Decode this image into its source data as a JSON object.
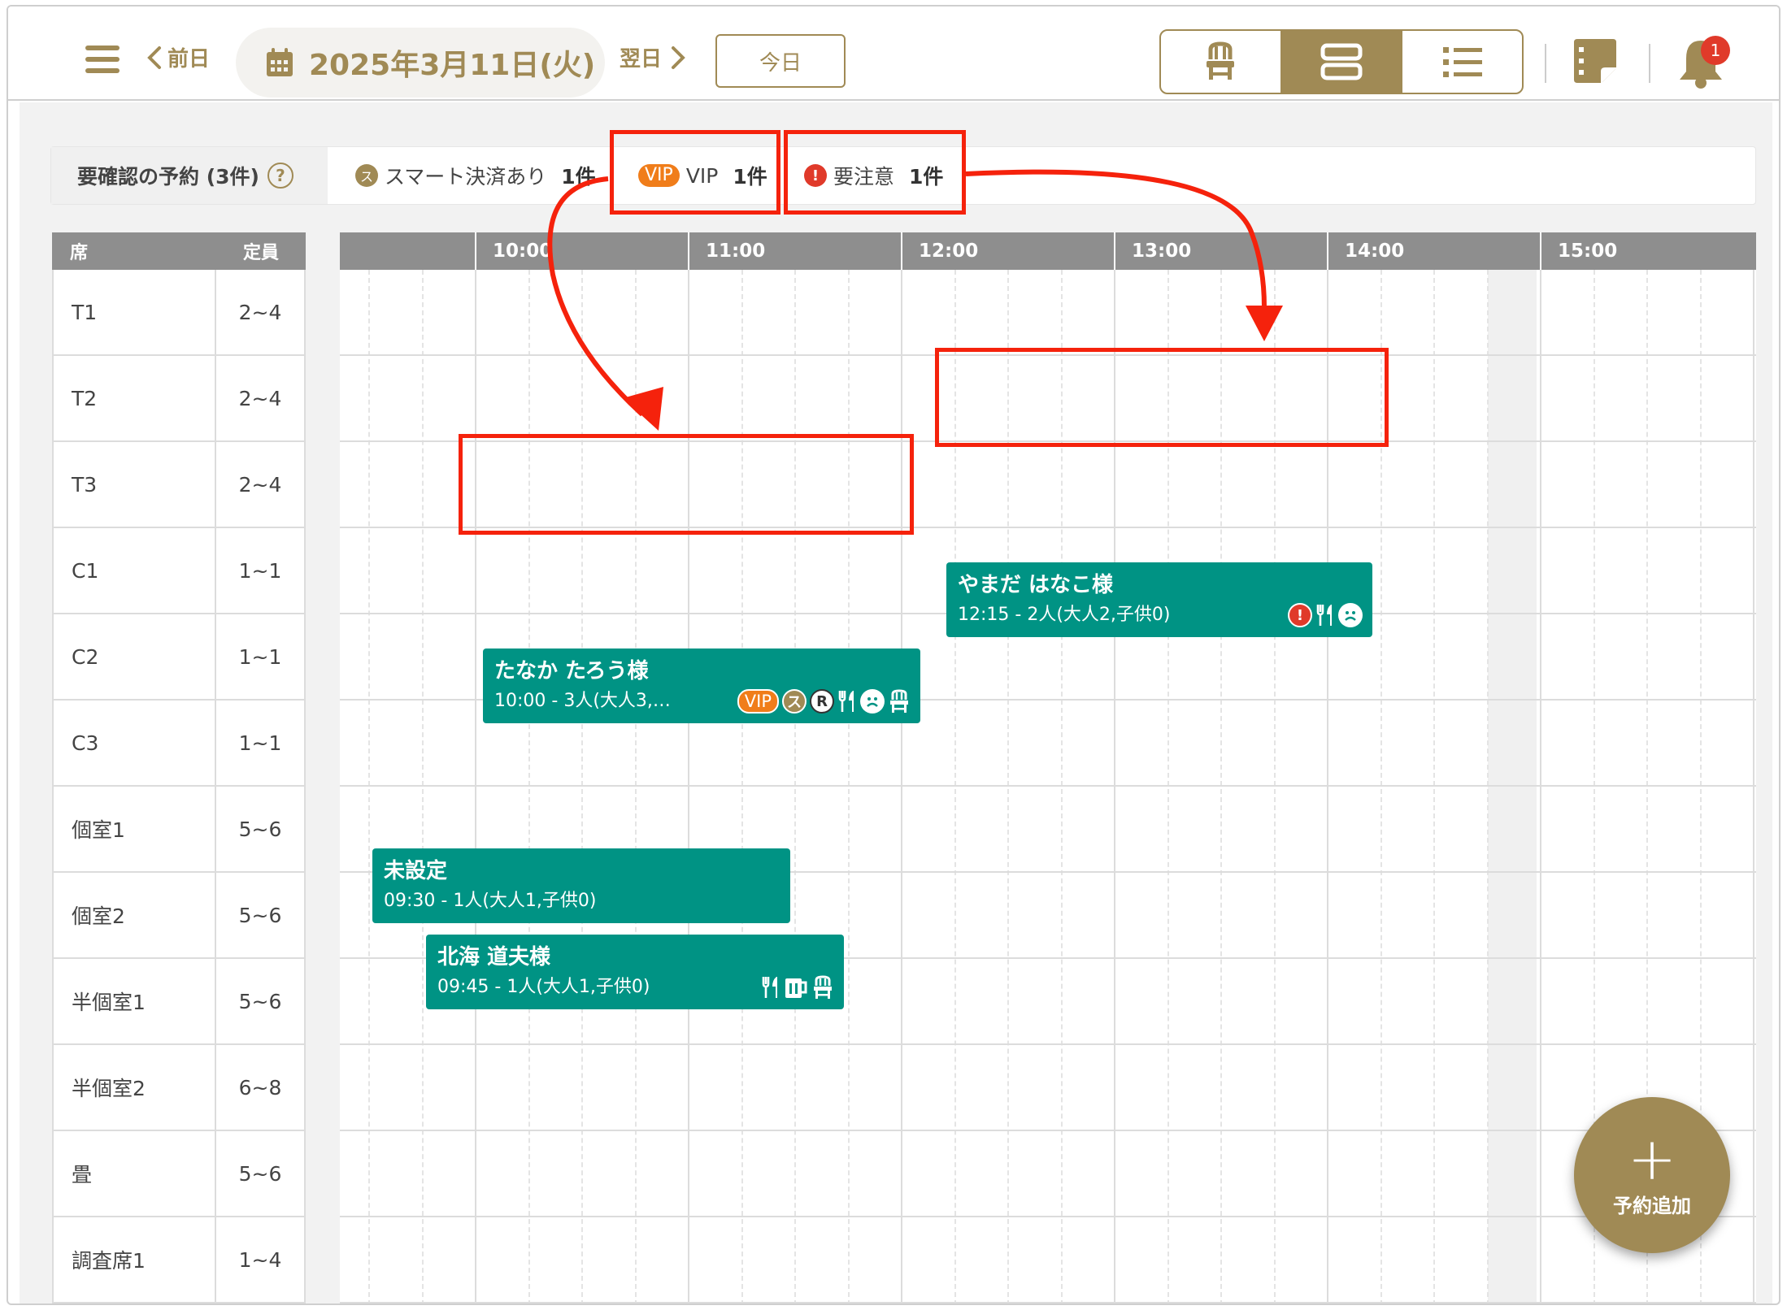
{
  "header": {
    "prev_label": "前日",
    "date_label": "2025年3月11日(火)",
    "next_label": "翌日",
    "today_label": "今日",
    "notification_count": "1"
  },
  "filter": {
    "label": "要確認の予約 (3件)",
    "help": "?",
    "smart_icon": "ス",
    "smart_label": "スマート決済あり",
    "smart_count": "1件",
    "vip_chip": "VIP",
    "vip_label": "VIP",
    "vip_count": "1件",
    "caution_icon": "!",
    "caution_label": "要注意",
    "caution_count": "1件"
  },
  "seats": {
    "head_name": "席",
    "head_cap": "定員",
    "rows": [
      {
        "name": "T1",
        "cap": "2~4"
      },
      {
        "name": "T2",
        "cap": "2~4"
      },
      {
        "name": "T3",
        "cap": "2~4"
      },
      {
        "name": "C1",
        "cap": "1~1"
      },
      {
        "name": "C2",
        "cap": "1~1"
      },
      {
        "name": "C3",
        "cap": "1~1"
      },
      {
        "name": "個室1",
        "cap": "5~6"
      },
      {
        "name": "個室2",
        "cap": "5~6"
      },
      {
        "name": "半個室1",
        "cap": "5~6"
      },
      {
        "name": "半個室2",
        "cap": "6~8"
      },
      {
        "name": "畳",
        "cap": "5~6"
      },
      {
        "name": "調査席1",
        "cap": "1~4"
      }
    ]
  },
  "timeline": {
    "hours": [
      "10:00",
      "11:00",
      "12:00",
      "13:00",
      "14:00",
      "15:00"
    ]
  },
  "reservations": [
    {
      "name": "やまだ はなこ様",
      "detail": "12:15 - 2人(大人2,子供0)",
      "icons": [
        "warning-icon",
        "cutlery-icon",
        "sad-face-icon"
      ]
    },
    {
      "name": "たなか たろう様",
      "detail": "10:00 - 3人(大人3,…",
      "icons": [
        "vip-badge",
        "smart-pay-icon",
        "r-icon",
        "cutlery-icon",
        "sad-face-icon",
        "chair-icon"
      ],
      "vip": "VIP",
      "smart": "ス",
      "r": "R"
    },
    {
      "name": "未設定",
      "detail": "09:30 - 1人(大人1,子供0)",
      "icons": []
    },
    {
      "name": "北海 道夫様",
      "detail": "09:45 - 1人(大人1,子供0)",
      "icons": [
        "cutlery-icon",
        "beer-icon",
        "chair-icon"
      ]
    }
  ],
  "fab": {
    "plus": "+",
    "label": "予約追加"
  },
  "colors": {
    "accent": "#a08a55",
    "reservation": "#009384",
    "highlight": "#f5220c",
    "vip": "#f07d1a",
    "warning": "#e03a2a"
  }
}
